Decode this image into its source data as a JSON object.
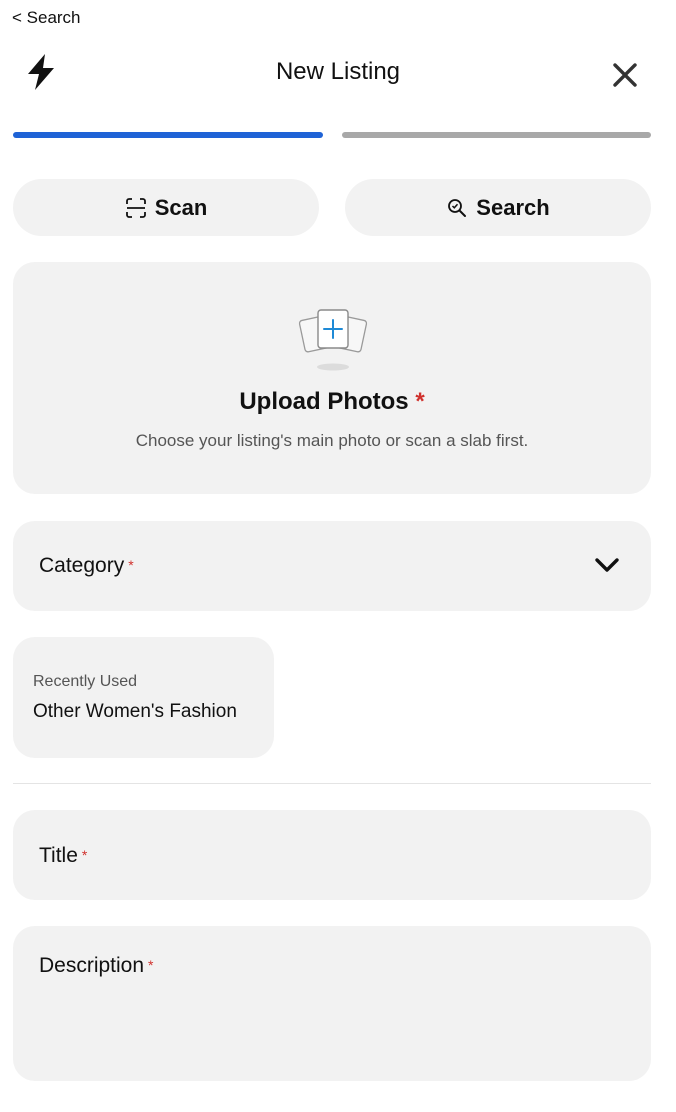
{
  "status": {
    "back_label": "< Search"
  },
  "header": {
    "title": "New Listing",
    "logo_icon": "bolt-icon",
    "close_icon": "close-icon"
  },
  "progress": {
    "current_step": 1,
    "total_steps": 2,
    "colors": {
      "active": "#1f63d6",
      "inactive": "#a8a8a8"
    }
  },
  "actions": {
    "scan": {
      "label": "Scan",
      "icon": "scan-icon"
    },
    "search": {
      "label": "Search",
      "icon": "search-icon"
    }
  },
  "upload": {
    "title": "Upload Photos",
    "required_mark": "*",
    "subtitle": "Choose your listing's main photo or scan a slab first.",
    "icon": "add-photos-icon"
  },
  "category": {
    "label": "Category",
    "required_mark": "*",
    "icon": "chevron-down-icon"
  },
  "recent": {
    "caption": "Recently Used",
    "value": "Other Women's Fashion"
  },
  "title_field": {
    "label": "Title",
    "required_mark": "*"
  },
  "description_field": {
    "label": "Description",
    "required_mark": "*"
  },
  "colors": {
    "accent": "#1f63d6",
    "required": "#d0312d",
    "field_bg": "#f2f2f2"
  }
}
